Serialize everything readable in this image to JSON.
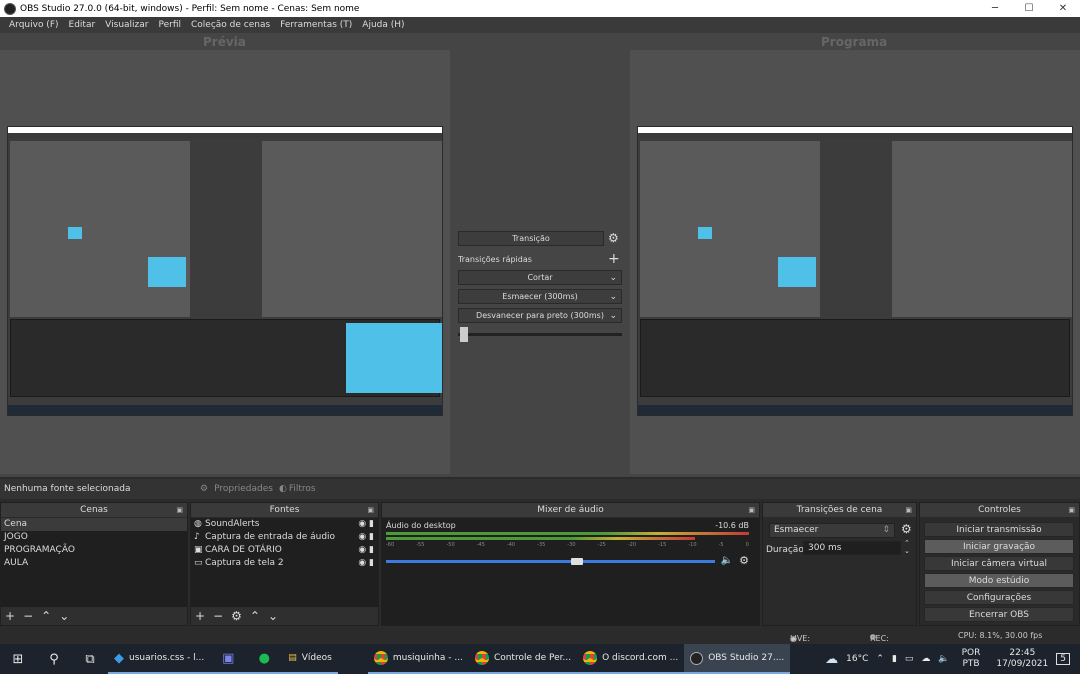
{
  "window": {
    "title": "OBS Studio 27.0.0 (64-bit, windows) - Perfil: Sem nome - Cenas: Sem nome",
    "minimize": "─",
    "maximize": "☐",
    "close": "✕"
  },
  "menu": [
    "Arquivo (F)",
    "Editar",
    "Visualizar",
    "Perfil",
    "Coleção de cenas",
    "Ferramentas (T)",
    "Ajuda (H)"
  ],
  "preview": {
    "left_label": "Prévia",
    "right_label": "Programa"
  },
  "transitions_center": {
    "transition_button": "Transição",
    "quick_label": "Transições rápidas",
    "items": [
      "Cortar",
      "Esmaecer (300ms)",
      "Desvanecer para preto (300ms)"
    ]
  },
  "source_bar": {
    "no_source": "Nenhuma fonte selecionada",
    "properties": "Propriedades",
    "filters": "Filtros"
  },
  "scenes": {
    "title": "Cenas",
    "items": [
      "Cena",
      "JOGO",
      "PROGRAMAÇÃO",
      "AULA"
    ]
  },
  "sources": {
    "title": "Fontes",
    "items": [
      "SoundAlerts",
      "Captura de entrada de áudio",
      "CARA DE OTÁRIO",
      "Captura de tela 2"
    ]
  },
  "mixer": {
    "title": "Mixer de áudio",
    "track_name": "Áudio do desktop",
    "level": "-10.6 dB",
    "scale": [
      "-60",
      "-55",
      "-50",
      "-45",
      "-40",
      "-35",
      "-30",
      "-25",
      "-20",
      "-15",
      "-10",
      "-5",
      "0"
    ],
    "volume": 0.58
  },
  "scene_transitions": {
    "title": "Transições de cena",
    "selected": "Esmaecer",
    "duration_label": "Duração",
    "duration_value": "300 ms"
  },
  "controls": {
    "title": "Controles",
    "buttons": [
      "Iniciar transmissão",
      "Iniciar gravação",
      "Iniciar câmera virtual",
      "Modo estúdio",
      "Configurações",
      "Encerrar OBS"
    ]
  },
  "status": {
    "live": "LIVE: 00:00:00",
    "rec": "REC: 00:00:00",
    "cpu": "CPU: 8.1%, 30.00 fps"
  },
  "taskbar": {
    "apps": [
      "usuarios.css - l...",
      "Vídeos",
      "musiquinha - ...",
      "Controle de Per...",
      "O discord.com ...",
      "OBS Studio 27...."
    ],
    "weather": "16°C",
    "lang1": "POR",
    "lang2": "PTB",
    "time": "22:45",
    "date": "17/09/2021",
    "notifications": "5"
  },
  "colors": {
    "accent_blue": "#3d7adf",
    "preview_cyan": "#4fc0e8"
  }
}
